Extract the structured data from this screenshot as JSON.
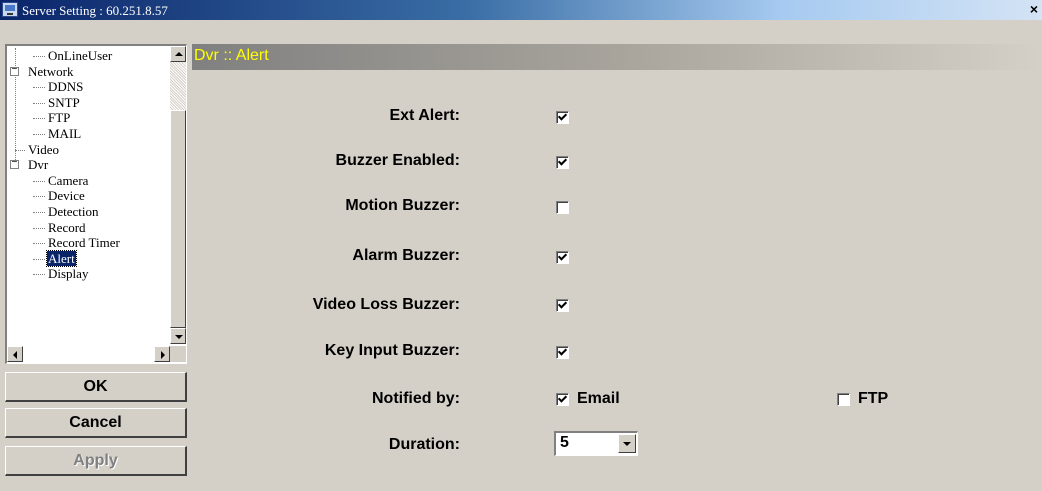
{
  "window": {
    "title": "Server Setting : 60.251.8.57",
    "close_glyph": "×",
    "icon": "server-window-icon"
  },
  "tree": {
    "nodes": [
      {
        "label": "OnLineUser",
        "level": 1,
        "selected": false
      },
      {
        "label": "Network",
        "level": 0,
        "expander": "−"
      },
      {
        "label": "DDNS",
        "level": 1
      },
      {
        "label": "SNTP",
        "level": 1
      },
      {
        "label": "FTP",
        "level": 1
      },
      {
        "label": "MAIL",
        "level": 1
      },
      {
        "label": "Video",
        "level": 0
      },
      {
        "label": "Dvr",
        "level": 0,
        "expander": "−"
      },
      {
        "label": "Camera",
        "level": 1
      },
      {
        "label": "Device",
        "level": 1
      },
      {
        "label": "Detection",
        "level": 1
      },
      {
        "label": "Record",
        "level": 1
      },
      {
        "label": "Record Timer",
        "level": 1
      },
      {
        "label": "Alert",
        "level": 1,
        "selected": true
      },
      {
        "label": "Display",
        "level": 1
      }
    ]
  },
  "buttons": {
    "ok": "OK",
    "cancel": "Cancel",
    "apply": "Apply"
  },
  "section": {
    "title": "Dvr :: Alert"
  },
  "settings": {
    "ext_alert": {
      "label": "Ext Alert:",
      "checked": true
    },
    "buzzer_enabled": {
      "label": "Buzzer Enabled:",
      "checked": true
    },
    "motion_buzzer": {
      "label": "Motion Buzzer:",
      "checked": false
    },
    "alarm_buzzer": {
      "label": "Alarm Buzzer:",
      "checked": true
    },
    "video_loss_buzzer": {
      "label": "Video Loss Buzzer:",
      "checked": true
    },
    "key_input_buzzer": {
      "label": "Key Input Buzzer:",
      "checked": true
    },
    "notified_by": {
      "label": "Notified by:",
      "email": {
        "label": "Email",
        "checked": true
      },
      "ftp": {
        "label": "FTP",
        "checked": false
      }
    },
    "duration": {
      "label": "Duration:",
      "value": "5"
    }
  },
  "colors": {
    "title_bar": "#0a246a",
    "section_title": "#ffff00",
    "selection": "#0a246a",
    "face": "#d4d0c8"
  }
}
